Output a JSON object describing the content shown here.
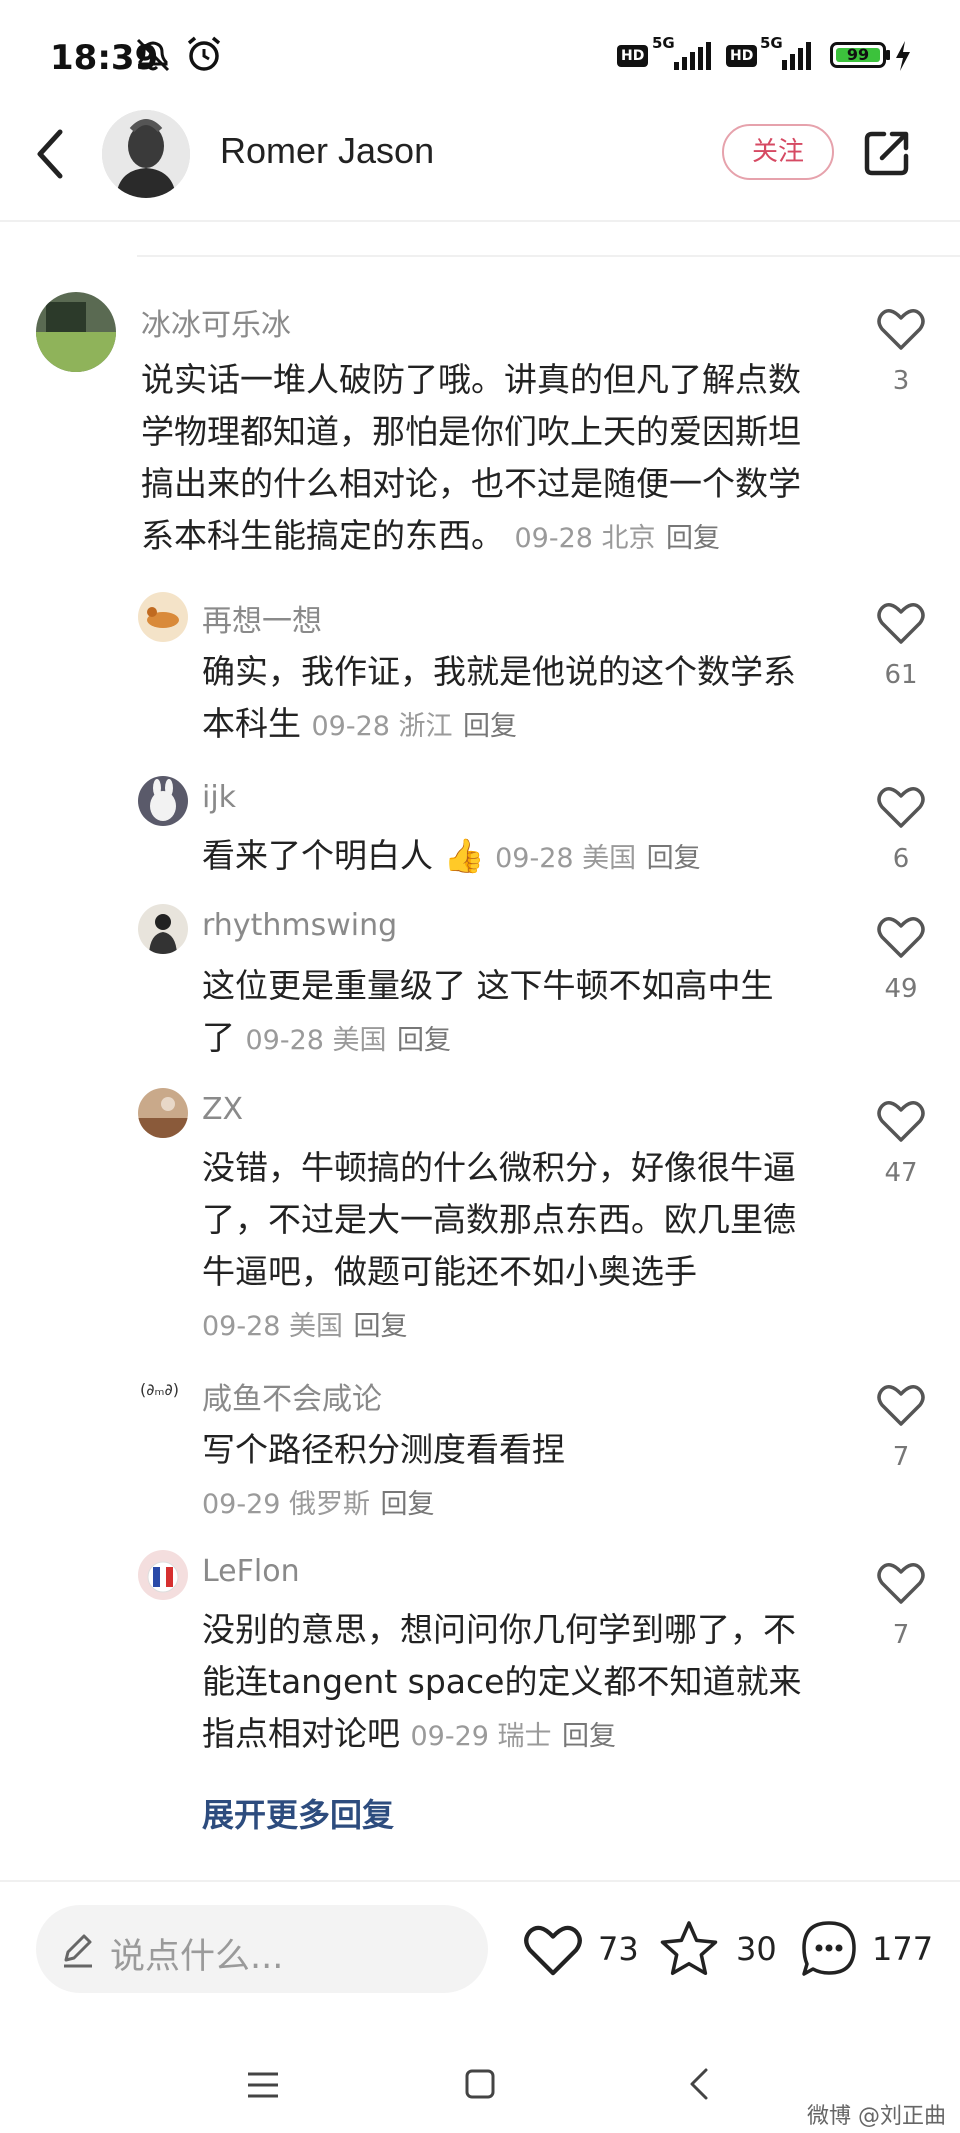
{
  "status_bar": {
    "time": "18:39",
    "hd1": "HD",
    "net1": "5G",
    "hd2": "HD",
    "net2": "5G",
    "battery": "99"
  },
  "header": {
    "author_name": "Romer Jason",
    "follow_label": "关注"
  },
  "comment": {
    "username": "冰冰可乐冰",
    "lines": [
      "说实话一堆人破防了哦。讲真的但凡了解点数",
      "学物理都知道，那怕是你们吹上天的爱因斯坦",
      "搞出来的什么相对论，也不过是随便一个数学"
    ],
    "last_line": "系本科生能搞定的东西。",
    "meta": "09-28 北京",
    "reply_label": "回复",
    "likes": "3"
  },
  "replies": [
    {
      "username": "再想一想",
      "lines": [
        "确实，我作证，我就是他说的这个数学系"
      ],
      "last_line": "本科生",
      "meta": "09-28 浙江",
      "reply_label": "回复",
      "likes": "61"
    },
    {
      "username": "ijk",
      "lines": [],
      "last_line": "看来了个明白人 👍",
      "meta": "09-28 美国",
      "reply_label": "回复",
      "likes": "6"
    },
    {
      "username": "rhythmswing",
      "lines": [
        "这位更是重量级了 这下牛顿不如高中生"
      ],
      "last_line": "了",
      "meta": "09-28 美国",
      "reply_label": "回复",
      "likes": "49"
    },
    {
      "username": "ZX",
      "lines": [
        "没错，牛顿搞的什么微积分，好像很牛逼",
        "了，不过是大一高数那点东西。欧几里德",
        "牛逼吧，做题可能还不如小奥选手"
      ],
      "last_line": "",
      "meta": "09-28 美国",
      "reply_label": "回复",
      "likes": "47"
    },
    {
      "username": "咸鱼不会咸论",
      "avatar_text": "(∂ₘ∂)",
      "lines": [
        "写个路径积分测度看看捏"
      ],
      "last_line": "",
      "meta": "09-29 俄罗斯",
      "reply_label": "回复",
      "likes": "7"
    },
    {
      "username": "LeFlon",
      "lines": [
        "没别的意思，想问问你几何学到哪了，不",
        "能连tangent space的定义都不知道就来"
      ],
      "last_line": "指点相对论吧",
      "meta": "09-29 瑞士",
      "reply_label": "回复",
      "likes": "7"
    }
  ],
  "expand_label": "展开更多回复",
  "bottom_bar": {
    "input_placeholder": "说点什么...",
    "likes": "73",
    "stars": "30",
    "comments": "177"
  },
  "watermark": "微博 @刘正曲"
}
